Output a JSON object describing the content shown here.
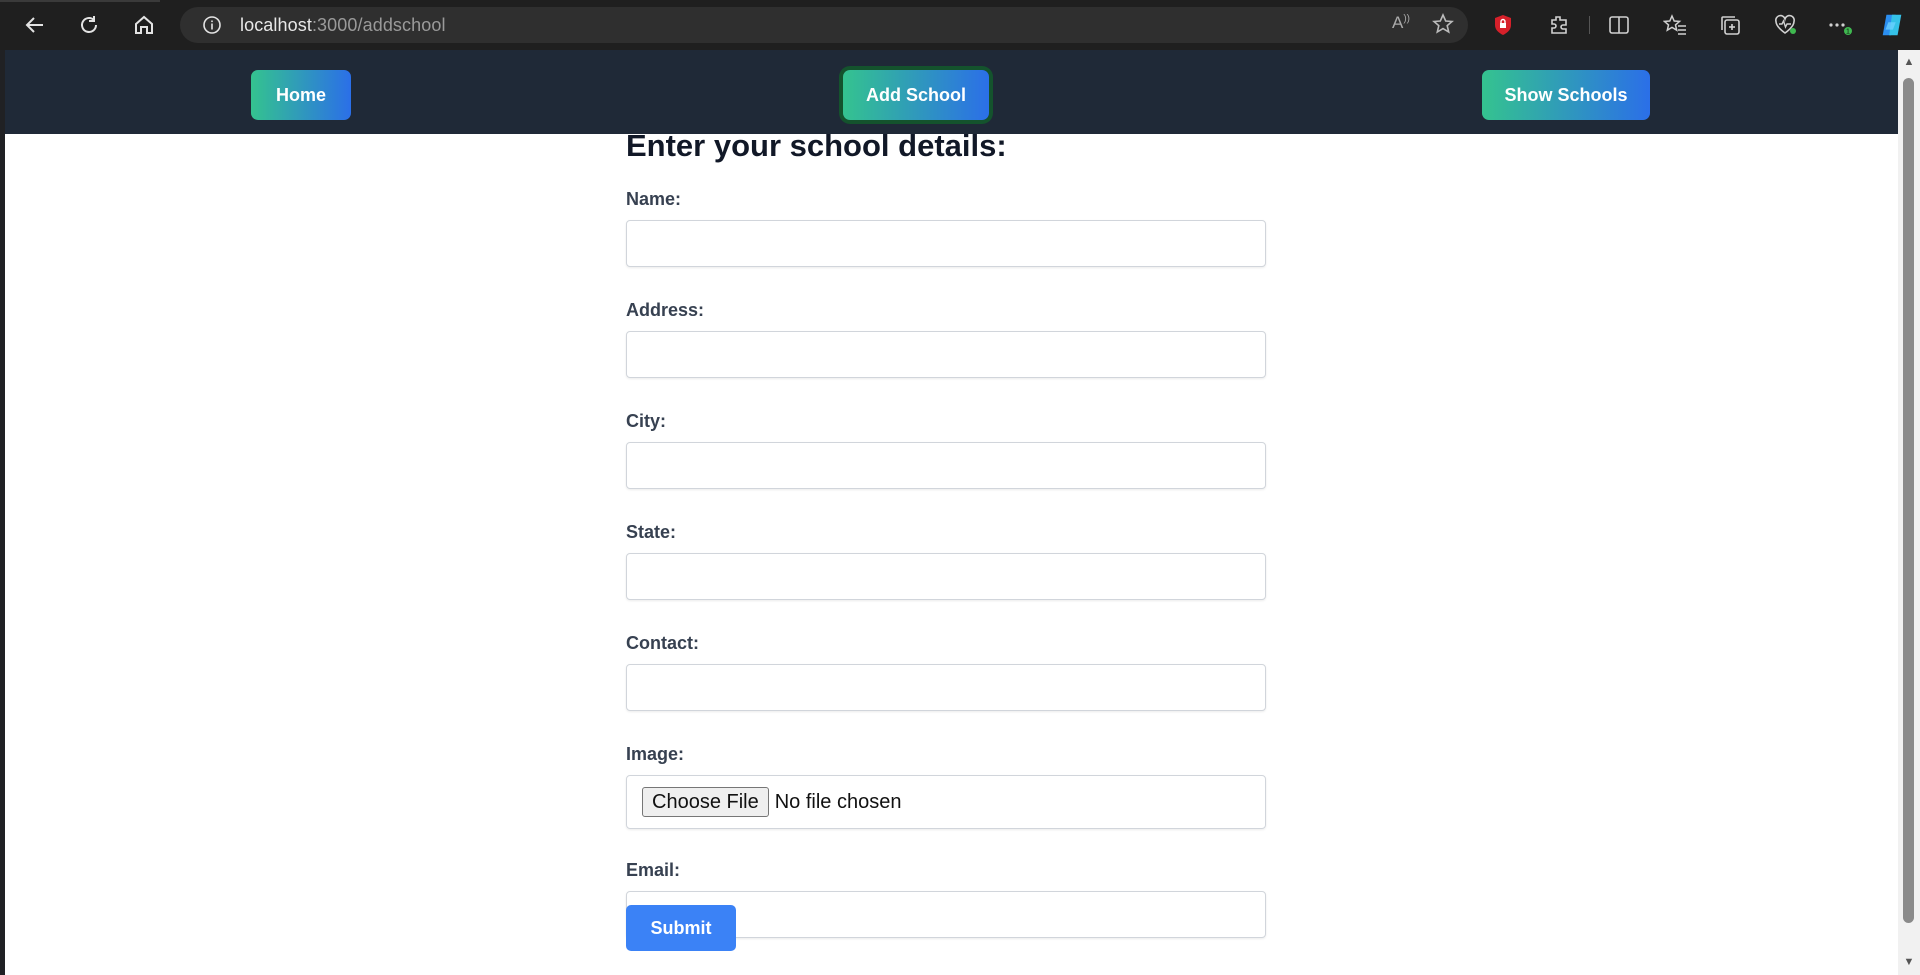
{
  "browser": {
    "url_host": "localhost",
    "url_path": ":3000/addschool"
  },
  "navbar": {
    "home_label": "Home",
    "add_school_label": "Add School",
    "show_schools_label": "Show Schools"
  },
  "form": {
    "title": "Enter your school details:",
    "fields": [
      {
        "label": "Name:",
        "value": ""
      },
      {
        "label": "Address:",
        "value": ""
      },
      {
        "label": "City:",
        "value": ""
      },
      {
        "label": "State:",
        "value": ""
      },
      {
        "label": "Contact:",
        "value": ""
      }
    ],
    "image": {
      "label": "Image:",
      "button_label": "Choose File",
      "status": "No file chosen"
    },
    "email": {
      "label": "Email:",
      "value": ""
    },
    "submit_label": "Submit"
  },
  "colors": {
    "navbar_bg": "#1f2937",
    "button_gradient_start": "#34c38f",
    "button_gradient_end": "#2b6fe8",
    "submit_bg": "#3b82f6"
  }
}
